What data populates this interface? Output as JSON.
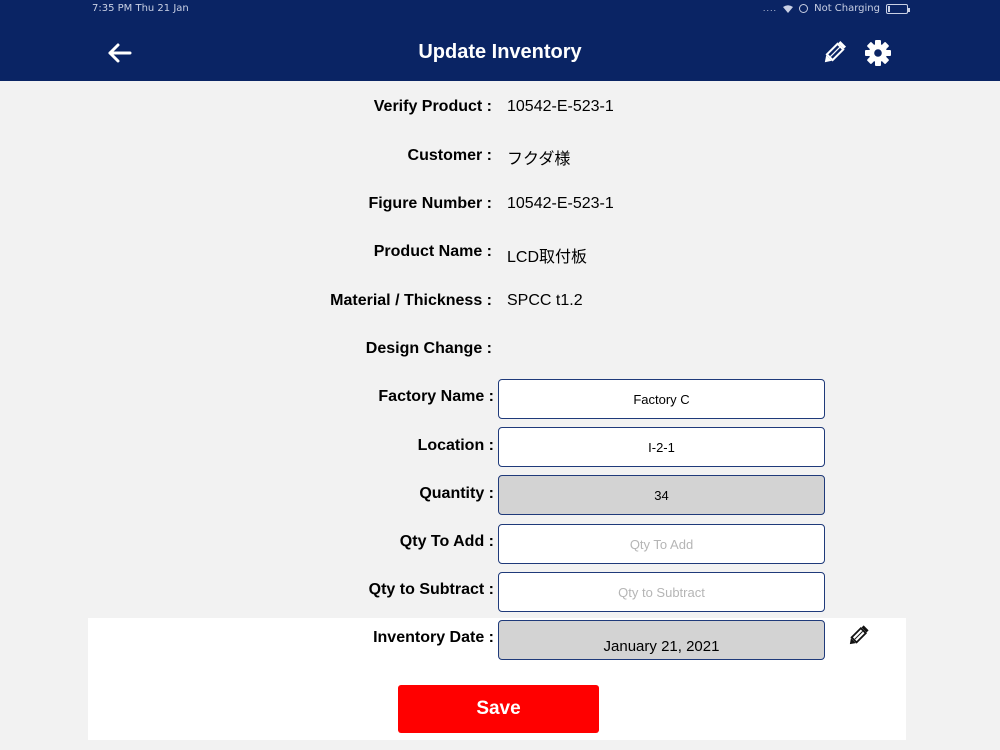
{
  "status_bar": {
    "time": "7:35 PM   Thu 21 Jan",
    "signal": "....",
    "charging": "Not Charging",
    "battery_level": 0.1
  },
  "header": {
    "title": "Update Inventory",
    "back_icon": "arrow-left-icon",
    "edit_icon": "pencil-icon",
    "settings_icon": "gear-icon",
    "background_color": "#0a2464"
  },
  "details": {
    "verify_product": {
      "label": "Verify Product :",
      "value": "10542-E-523-1"
    },
    "customer": {
      "label": "Customer :",
      "value": "フクダ様"
    },
    "figure_number": {
      "label": "Figure Number :",
      "value": "10542-E-523-1"
    },
    "product_name": {
      "label": "Product Name :",
      "value": "LCD取付板"
    },
    "material_thickness": {
      "label": "Material / Thickness :",
      "value": "SPCC t1.2"
    },
    "design_change": {
      "label": "Design Change :",
      "value": ""
    }
  },
  "form": {
    "factory_name": {
      "label": "Factory Name :",
      "value": "Factory C"
    },
    "location": {
      "label": "Location :",
      "value": "I-2-1"
    },
    "quantity": {
      "label": "Quantity :",
      "value": "34"
    },
    "qty_to_add": {
      "label": "Qty To Add :",
      "value": "",
      "placeholder": "Qty To Add"
    },
    "qty_to_subtract": {
      "label": "Qty to Subtract :",
      "value": "",
      "placeholder": "Qty to Subtract"
    },
    "inventory_date": {
      "label": "Inventory Date :",
      "value": "January 21, 2021"
    }
  },
  "actions": {
    "save_label": "Save",
    "save_color": "#ff0000"
  }
}
